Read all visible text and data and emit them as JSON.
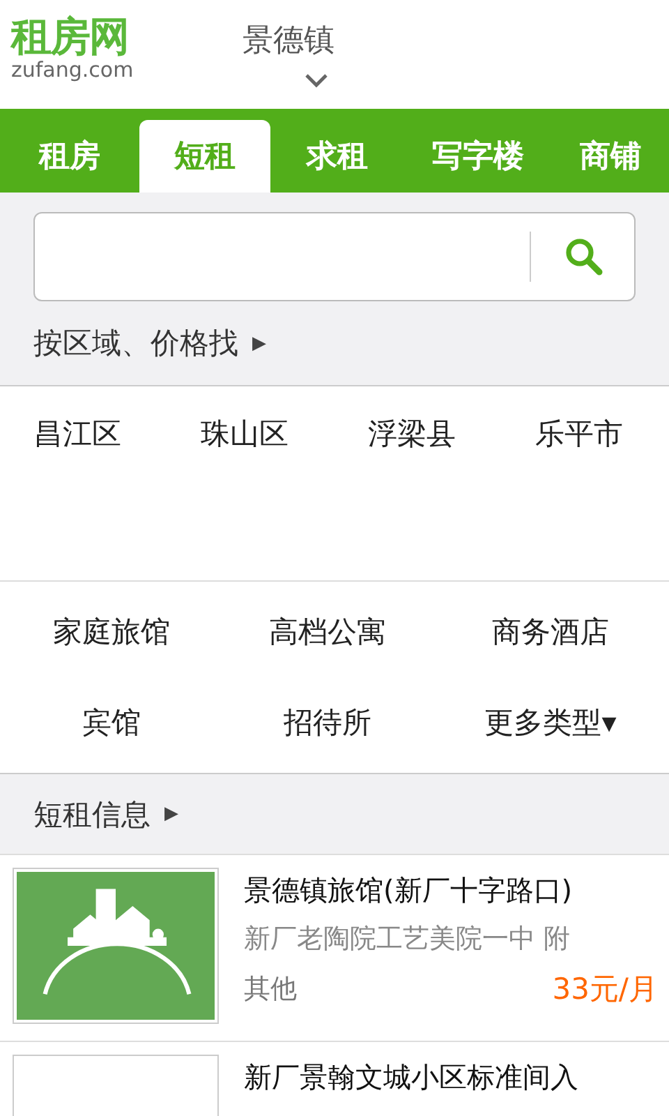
{
  "header": {
    "logo": {
      "name": "租房网",
      "domain": "zufang.com"
    },
    "city": "景德镇"
  },
  "tabs": [
    {
      "label": "租房",
      "selected": false
    },
    {
      "label": "短租",
      "selected": true
    },
    {
      "label": "求租",
      "selected": false
    },
    {
      "label": "写字楼",
      "selected": false
    },
    {
      "label": "商铺",
      "selected": false
    }
  ],
  "search": {
    "filter_link": "按区域、价格找",
    "filter_arrow": "▶"
  },
  "districts": [
    "昌江区",
    "珠山区",
    "浮梁县",
    "乐平市"
  ],
  "types": [
    "家庭旅馆",
    "高档公寓",
    "商务酒店",
    "宾馆",
    "招待所",
    "更多类型▾"
  ],
  "section": {
    "title": "短租信息",
    "arrow": "▶"
  },
  "listings": [
    {
      "title": "景德镇旅馆(新厂十字路口)",
      "address": "新厂老陶院工艺美院一中 附",
      "category": "其他",
      "price": "33元/月"
    },
    {
      "title": "新厂景翰文城小区标准间入"
    }
  ]
}
